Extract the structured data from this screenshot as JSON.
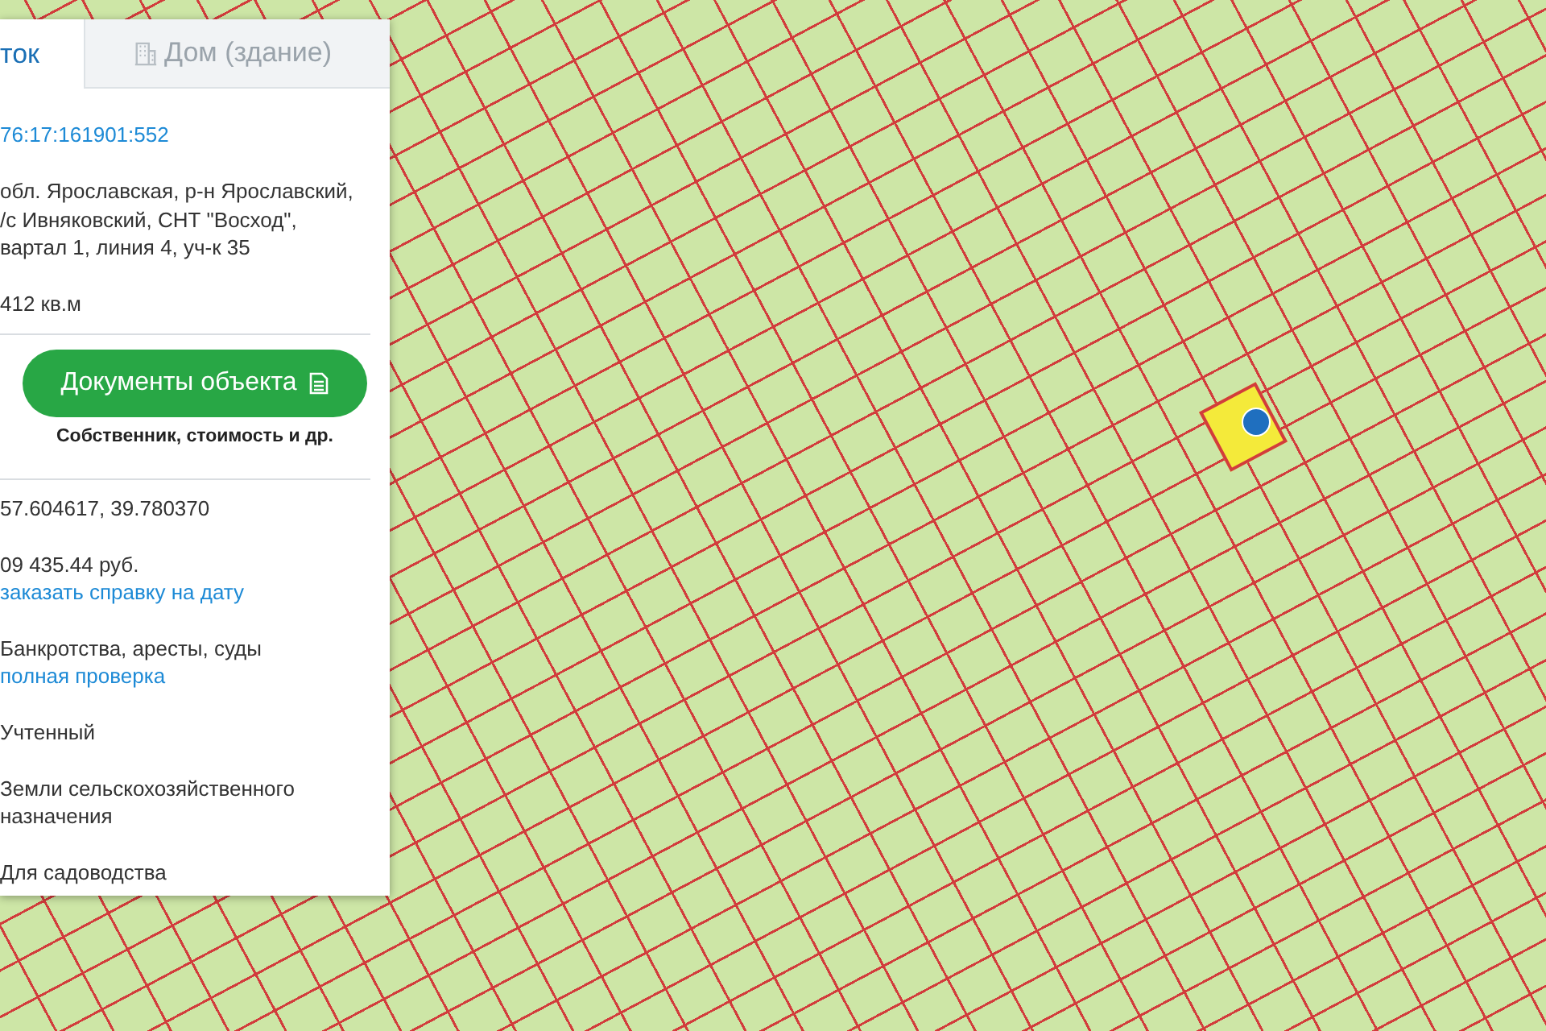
{
  "tabs": [
    {
      "label": "ток",
      "selected": true,
      "kind": "plot"
    },
    {
      "label": "Дом (здание)",
      "selected": false,
      "kind": "building"
    }
  ],
  "cadastral_number": "76:17:161901:552",
  "address_lines": [
    "обл. Ярославская, р-н Ярославский,",
    "/с Ивняковский, СНТ \"Восход\",",
    "вартал 1, линия 4, уч-к 35"
  ],
  "area": "412 кв.м",
  "documents_button": {
    "label": "Документы объекта",
    "caption": "Собственник, стоимость и др."
  },
  "details": [
    {
      "text": "57.604617, 39.780370"
    },
    {
      "text": "09 435.44 руб.",
      "link": "заказать справку на дату"
    },
    {
      "text": "Банкротства, аресты, суды",
      "link": "полная проверка"
    },
    {
      "text": "Учтенный"
    },
    {
      "text": "Земли сельскохозяйственного назначения"
    },
    {
      "text": "Для садоводства"
    }
  ]
}
